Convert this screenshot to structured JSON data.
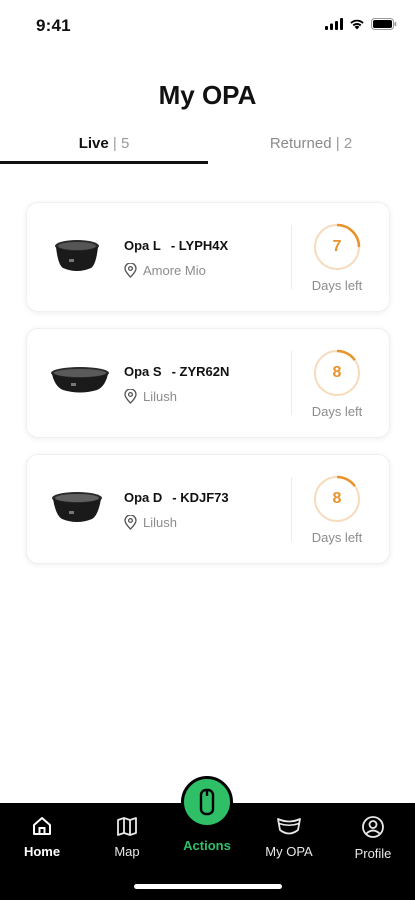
{
  "status_bar": {
    "time": "9:41"
  },
  "page": {
    "title": "My OPA"
  },
  "tabs": [
    {
      "label": "Live",
      "separator": "|",
      "count": "5"
    },
    {
      "label": "Returned",
      "separator": "|",
      "count": "2"
    }
  ],
  "items": [
    {
      "name": "Opa L",
      "code": "- LYPH4X",
      "location": "Amore Mio",
      "days": "7",
      "days_label": "Days left",
      "progress": 0.25
    },
    {
      "name": "Opa S",
      "code": "- ZYR62N",
      "location": "Lilush",
      "days": "8",
      "days_label": "Days left",
      "progress": 0.15
    },
    {
      "name": "Opa D",
      "code": "- KDJF73",
      "location": "Lilush",
      "days": "8",
      "days_label": "Days left",
      "progress": 0.15
    }
  ],
  "nav": {
    "home": "Home",
    "map": "Map",
    "actions": "Actions",
    "myopa": "My OPA",
    "profile": "Profile"
  },
  "colors": {
    "accent": "#e8932b",
    "action_green": "#2fbf66",
    "nav_bg": "#000000"
  },
  "icons": [
    "signal-icon",
    "wifi-icon",
    "battery-icon",
    "location-pin-icon",
    "home-icon",
    "map-icon",
    "container-icon",
    "bowl-icon",
    "profile-icon"
  ]
}
